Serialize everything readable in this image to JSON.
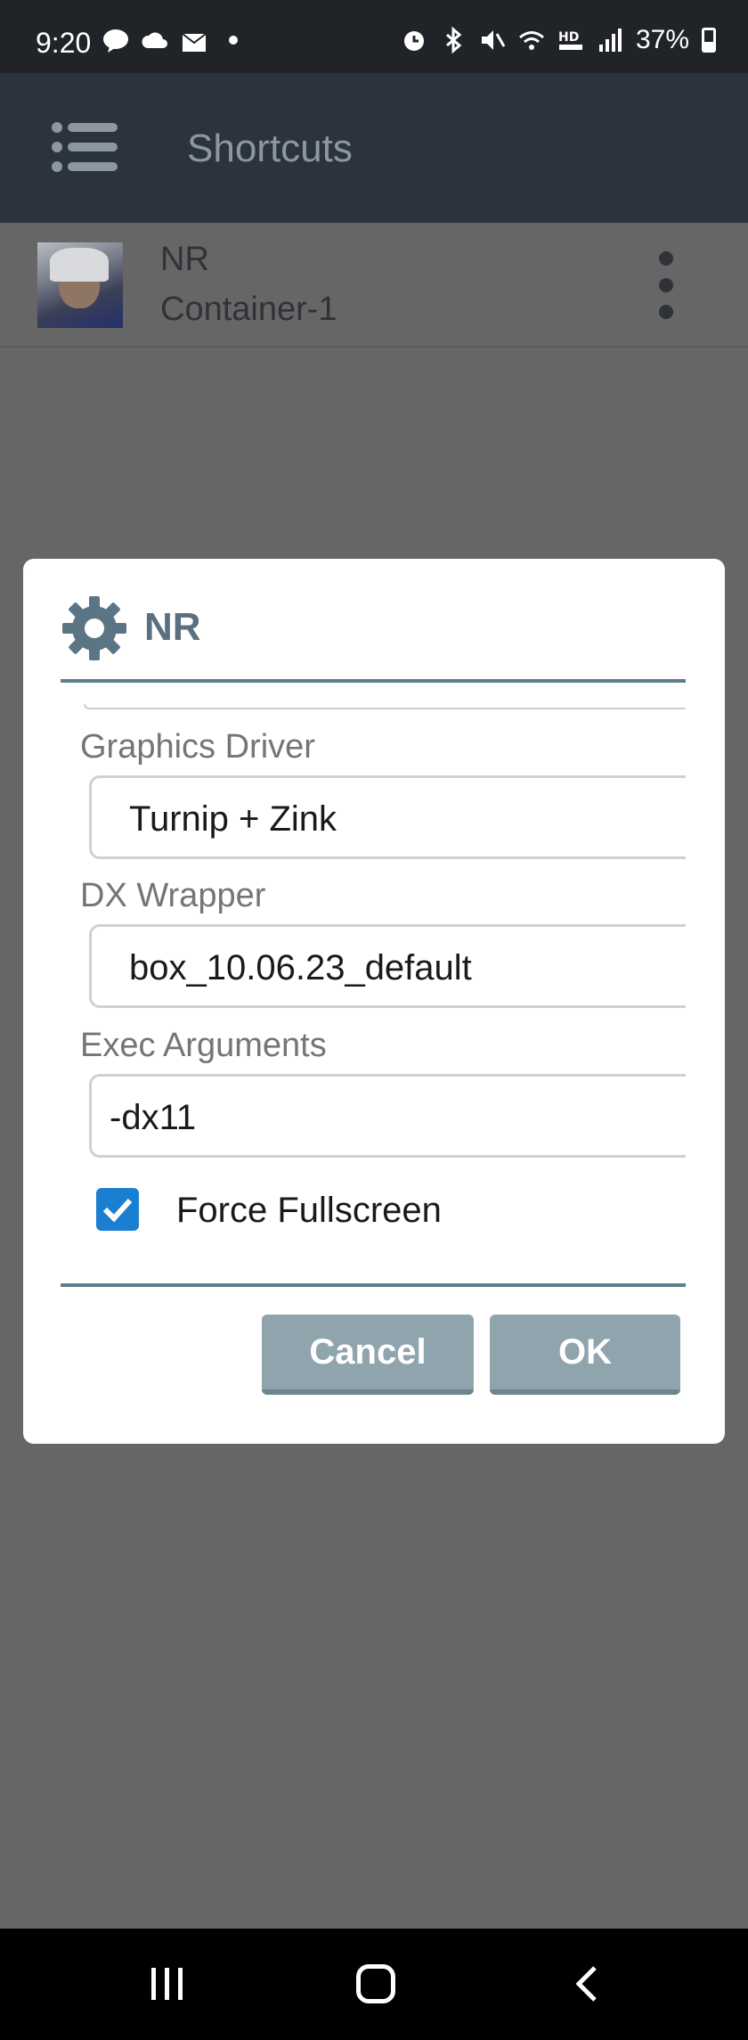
{
  "status_bar": {
    "time": "9:20",
    "battery": "37%",
    "left_icons": [
      "talk-icon",
      "cloud-icon",
      "mail-icon",
      "dot-icon"
    ],
    "right_icons": [
      "alarm-icon",
      "bluetooth-icon",
      "mute-icon",
      "wifi-icon",
      "hd-voice-icon",
      "signal-icon",
      "battery-icon"
    ]
  },
  "app_bar": {
    "title": "Shortcuts"
  },
  "shortcut": {
    "name": "NR",
    "container": "Container-1"
  },
  "dialog": {
    "title": "NR",
    "fields": {
      "graphics_driver": {
        "label": "Graphics Driver",
        "value": "Turnip + Zink"
      },
      "dx_wrapper": {
        "label": "DX Wrapper",
        "value": "box_10.06.23_default"
      },
      "exec_arguments": {
        "label": "Exec Arguments",
        "value": "-dx11"
      }
    },
    "force_fullscreen": {
      "label": "Force Fullscreen",
      "checked": true
    },
    "cancel_label": "Cancel",
    "ok_label": "OK"
  },
  "colors": {
    "accent": "#607d8b",
    "button": "#90a4ae",
    "checkbox": "#1a7fd0",
    "overlay": "#666666"
  }
}
